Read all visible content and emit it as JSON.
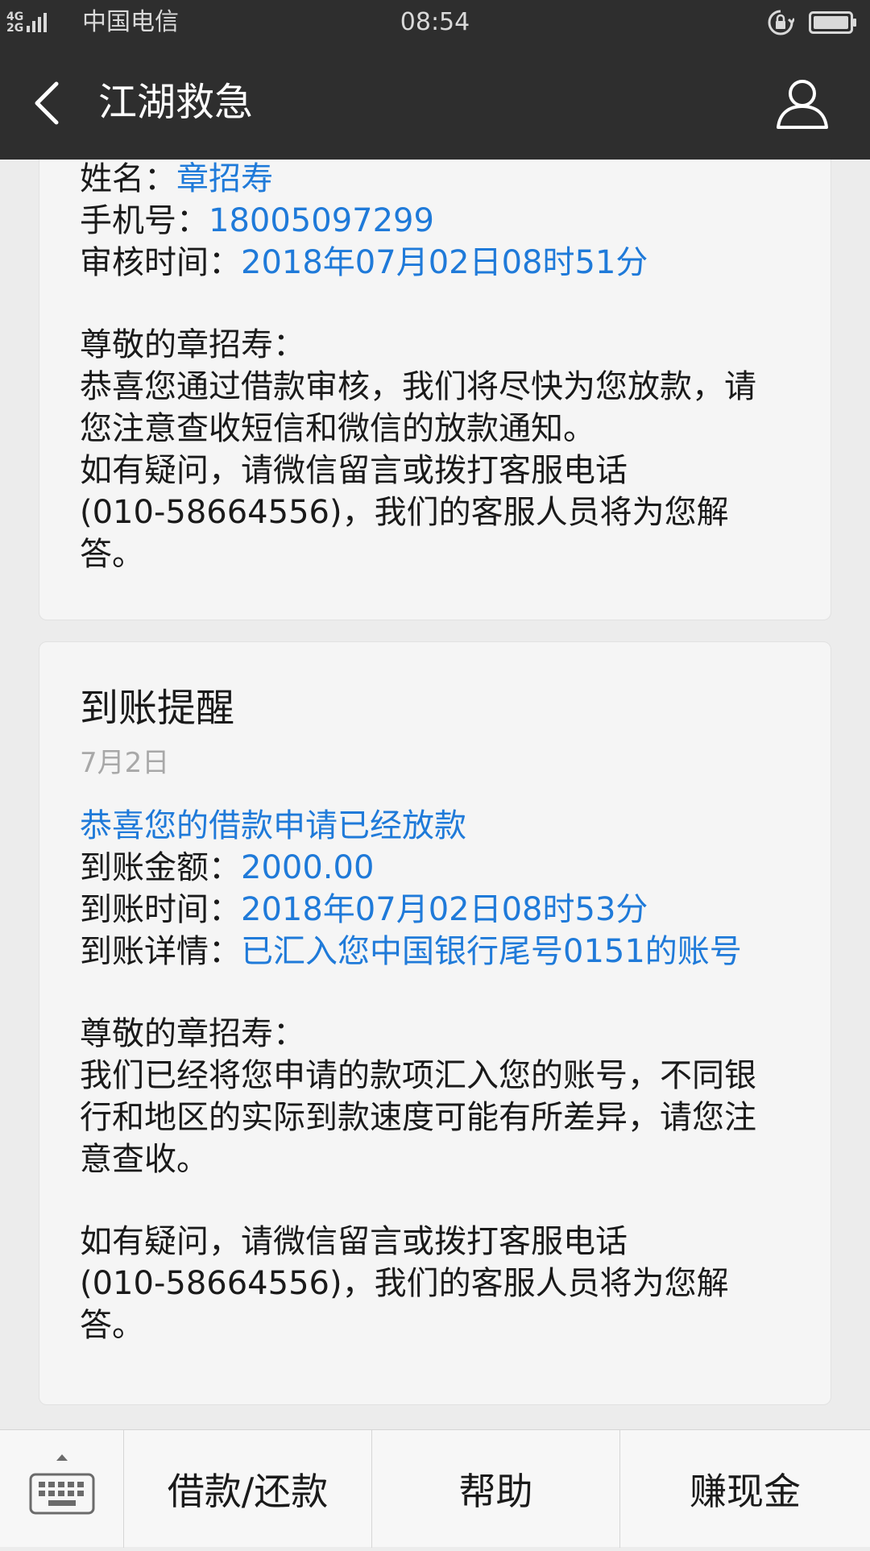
{
  "status_bar": {
    "network_types": [
      "4G",
      "2G"
    ],
    "carrier": "中国电信",
    "time": "08:54"
  },
  "header": {
    "title": "江湖救急"
  },
  "card_1": {
    "name_label": "姓名：",
    "name_value": "章招寿",
    "phone_label": "手机号：",
    "phone_value": "18005097299",
    "review_label": "审核时间：",
    "review_value": "2018年07月02日08时51分",
    "greeting": "尊敬的章招寿：",
    "body_lines": [
      "恭喜您通过借款审核，我们将尽快为您放款，请",
      "您注意查收短信和微信的放款通知。",
      "如有疑问，请微信留言或拨打客服电话",
      "(010-58664556)，我们的客服人员将为您解",
      "答。"
    ]
  },
  "card_2": {
    "title": "到账提醒",
    "date": "7月2日",
    "headline": "恭喜您的借款申请已经放款",
    "amount_label": "到账金额：",
    "amount_value": "2000.00",
    "time_label": "到账时间：",
    "time_value": "2018年07月02日08时53分",
    "detail_label": "到账详情：",
    "detail_value": "已汇入您中国银行尾号0151的账号",
    "greeting": "尊敬的章招寿：",
    "body_lines": [
      "我们已经将您申请的款项汇入您的账号，不同银",
      "行和地区的实际到款速度可能有所差异，请您注",
      "意查收。"
    ],
    "contact_lines": [
      "如有疑问，请微信留言或拨打客服电话",
      "(010-58664556)，我们的客服人员将为您解",
      "答。"
    ]
  },
  "bottom_menu": {
    "items": [
      "借款/还款",
      "帮助",
      "赚现金"
    ]
  },
  "colors": {
    "bar_bg": "#2e2e2e",
    "link_blue": "#1f7ad9",
    "card_bg": "#f5f5f5",
    "page_bg": "#ececec"
  },
  "icons": [
    "signal-icon",
    "lock-rotation-icon",
    "battery-icon",
    "back-arrow-icon",
    "profile-icon",
    "keyboard-icon"
  ]
}
